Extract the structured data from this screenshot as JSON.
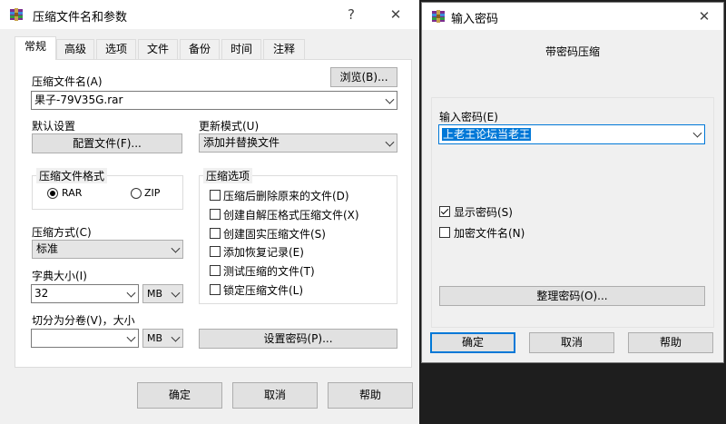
{
  "main_dialog": {
    "title": "压缩文件名和参数",
    "help_glyph": "?",
    "close_glyph": "✕",
    "tabs": [
      {
        "label": "常规"
      },
      {
        "label": "高级"
      },
      {
        "label": "选项"
      },
      {
        "label": "文件"
      },
      {
        "label": "备份"
      },
      {
        "label": "时间"
      },
      {
        "label": "注释"
      }
    ],
    "archive_name_label": "压缩文件名(A)",
    "browse_button": "浏览(B)...",
    "archive_name_value": "果子-79V35G.rar",
    "default_settings_label": "默认设置",
    "profiles_button": "配置文件(F)...",
    "update_mode_label": "更新模式(U)",
    "update_mode_value": "添加并替换文件",
    "format_group_label": "压缩文件格式",
    "format_rar": "RAR",
    "format_zip": "ZIP",
    "options_group_label": "压缩选项",
    "options": [
      {
        "label": "压缩后删除原来的文件(D)",
        "checked": false
      },
      {
        "label": "创建自解压格式压缩文件(X)",
        "checked": false
      },
      {
        "label": "创建固实压缩文件(S)",
        "checked": false
      },
      {
        "label": "添加恢复记录(E)",
        "checked": false
      },
      {
        "label": "测试压缩的文件(T)",
        "checked": false
      },
      {
        "label": "锁定压缩文件(L)",
        "checked": false
      }
    ],
    "method_label": "压缩方式(C)",
    "method_value": "标准",
    "dict_label": "字典大小(I)",
    "dict_value": "32",
    "dict_unit": "MB",
    "split_label": "切分为分卷(V)，大小",
    "split_value": "",
    "split_unit": "MB",
    "set_password_button": "设置密码(P)...",
    "ok_button": "确定",
    "cancel_button": "取消",
    "help_button": "帮助"
  },
  "password_dialog": {
    "title": "输入密码",
    "close_glyph": "✕",
    "heading": "带密码压缩",
    "enter_password_label": "输入密码(E)",
    "password_value": "上老王论坛当老王",
    "show_password_label": "显示密码(S)",
    "show_password_checked": true,
    "encrypt_names_label": "加密文件名(N)",
    "encrypt_names_checked": false,
    "organize_button": "整理密码(O)...",
    "ok_button": "确定",
    "cancel_button": "取消",
    "help_button": "帮助"
  }
}
